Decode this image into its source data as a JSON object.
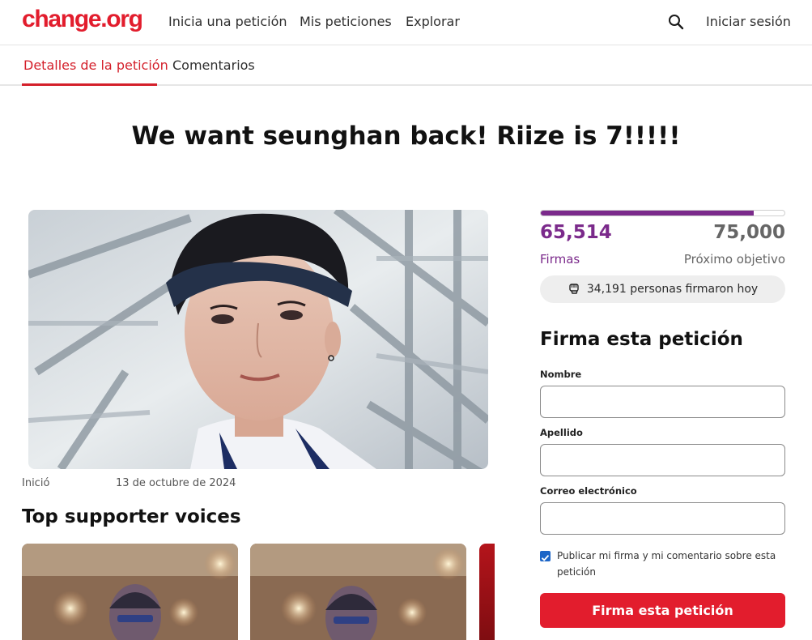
{
  "header": {
    "logo": "change.org",
    "nav": [
      "Inicia una petición",
      "Mis peticiones",
      "Explorar"
    ],
    "login_label": "Iniciar sesión",
    "search_icon": "search-icon"
  },
  "tabs": {
    "active": "Detalles de la petición",
    "other": "Comentarios"
  },
  "petition": {
    "title": "We want seunghan back! Riize is 7!!!!!",
    "start_label": "Inició",
    "start_date": "13 de octubre de 2024"
  },
  "voices": {
    "title": "Top supporter voices"
  },
  "signatures": {
    "count": "65,514",
    "count_label": "Firmas",
    "goal": "75,000",
    "goal_label": "Próximo objetivo",
    "progress": 0.874,
    "today": "34,191 personas firmaron hoy",
    "today_icon": "raised-fist-icon"
  },
  "form": {
    "title": "Firma esta petición",
    "first_name_label": "Nombre",
    "last_name_label": "Apellido",
    "email_label": "Correo electrónico",
    "publish_label": "Publicar mi firma y mi comentario sobre esta petición",
    "publish_checked": true,
    "submit_label": "Firma esta petición"
  },
  "colors": {
    "brand_red": "#e21d2d",
    "progress_purple": "#7b2a8b",
    "checkbox_blue": "#1c65c7"
  }
}
